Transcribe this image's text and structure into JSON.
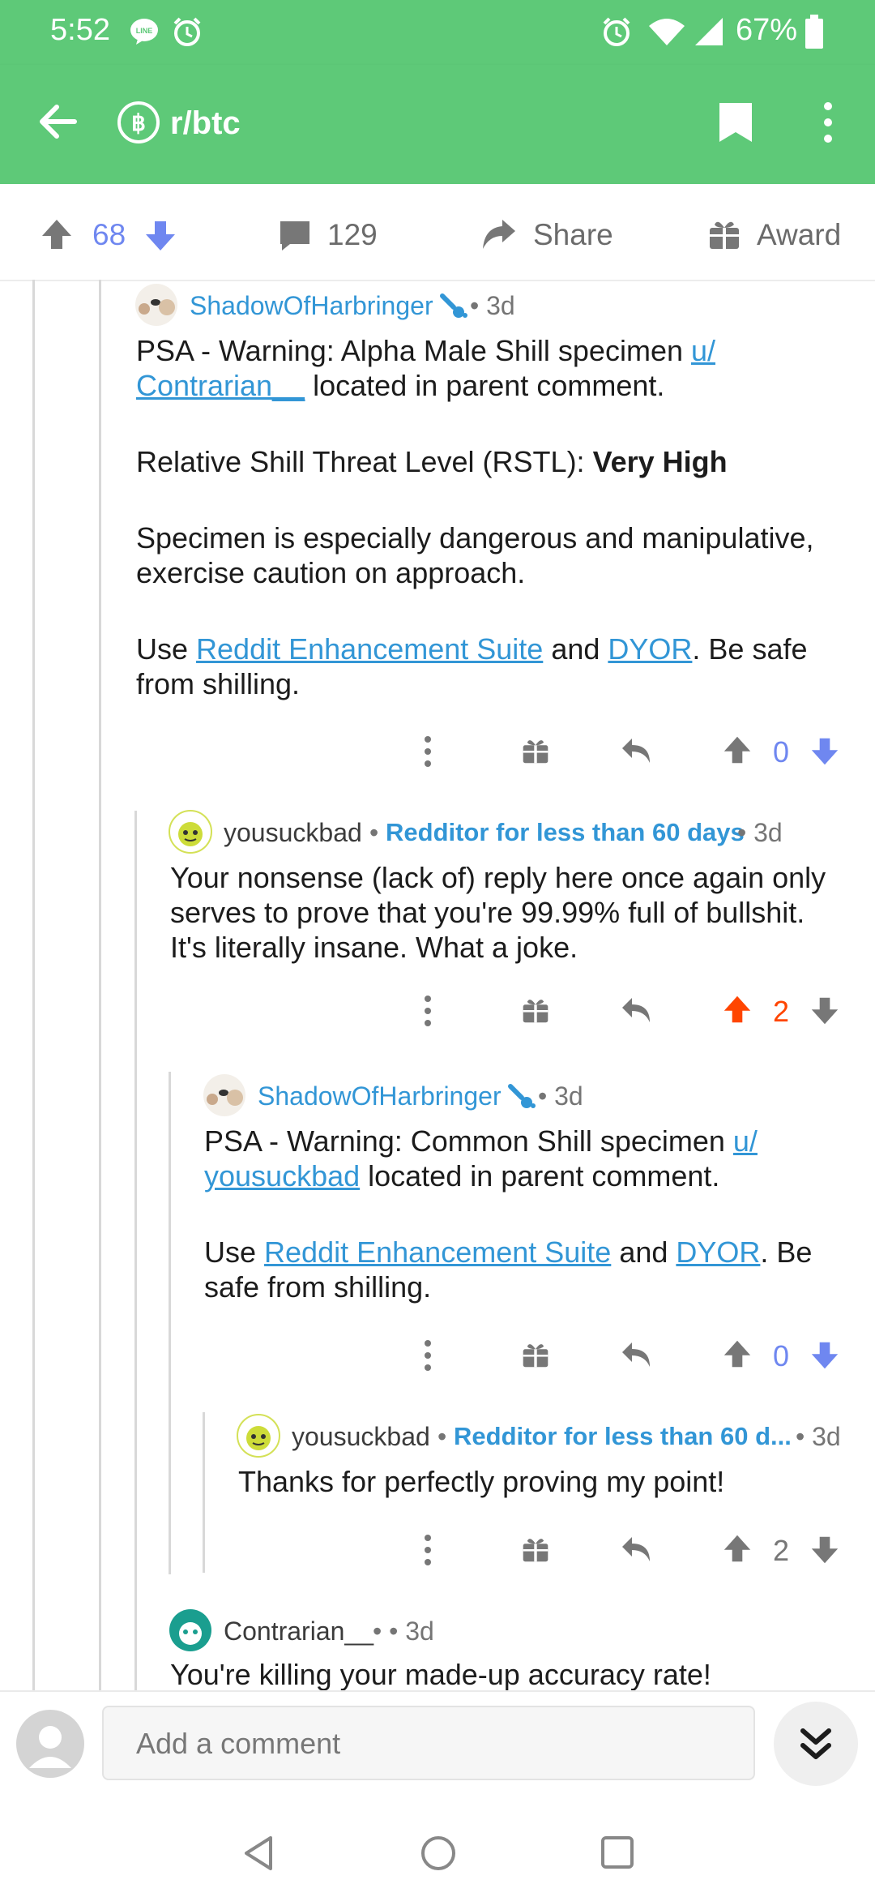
{
  "status_bar": {
    "time": "5:52",
    "battery": "67%"
  },
  "app_bar": {
    "subreddit": "r/btc"
  },
  "post_actions": {
    "upvotes": "68",
    "comments": "129",
    "share": "Share",
    "award": "Award"
  },
  "comments": [
    {
      "username": "ShadowOfHarbringer",
      "age": "3d",
      "paragraphs": {
        "p1_a": "PSA - Warning: Alpha Male Shill specimen ",
        "p1_link1": "u/",
        "p1_link2": "Contrarian__",
        "p1_b": " located in parent comment.",
        "p2_a": "Relative Shill Threat Level (RSTL): ",
        "p2_bold": "Very High",
        "p3_l1": "Specimen is especially dangerous and manipulative,",
        "p3_l2": "exercise caution on approach.",
        "p4_a": "Use ",
        "p4_link1": "Reddit Enhancement Suite",
        "p4_b": " and ",
        "p4_link2": "DYOR",
        "p4_c": ". Be safe",
        "p4_l2": "from shilling."
      },
      "score": "0"
    },
    {
      "username": "yousuckbad",
      "flair": "Redditor for less than 60 days",
      "age": "3d",
      "lines": [
        "Your nonsense (lack of) reply here once again only",
        "serves to prove that you're 99.99% full of bullshit.",
        "It's literally insane. What a joke."
      ],
      "score": "2"
    },
    {
      "username": "ShadowOfHarbringer",
      "age": "3d",
      "paragraphs": {
        "p1_a": "PSA - Warning: Common Shill specimen ",
        "p1_link1": "u/",
        "p1_link2": "yousuckbad",
        "p1_b": " located in parent comment.",
        "p2_a": "Use ",
        "p2_link1": "Reddit Enhancement Suite",
        "p2_b": " and ",
        "p2_link2": "DYOR",
        "p2_c": ". Be",
        "p2_l2": "safe from shilling."
      },
      "score": "0"
    },
    {
      "username": "yousuckbad",
      "flair": "Redditor for less than 60 d...",
      "age": "3d",
      "line": "Thanks for perfectly proving my point!",
      "score": "2"
    },
    {
      "username": "Contrarian__",
      "age": "3d",
      "line": "You're killing your made-up accuracy rate!"
    }
  ],
  "composer": {
    "placeholder": "Add a comment"
  },
  "colors": {
    "app_bar": "#5ec978",
    "link_blue": "#3296d6",
    "upvote_orange": "#ff4500",
    "vote_blue": "#6f87f0"
  }
}
